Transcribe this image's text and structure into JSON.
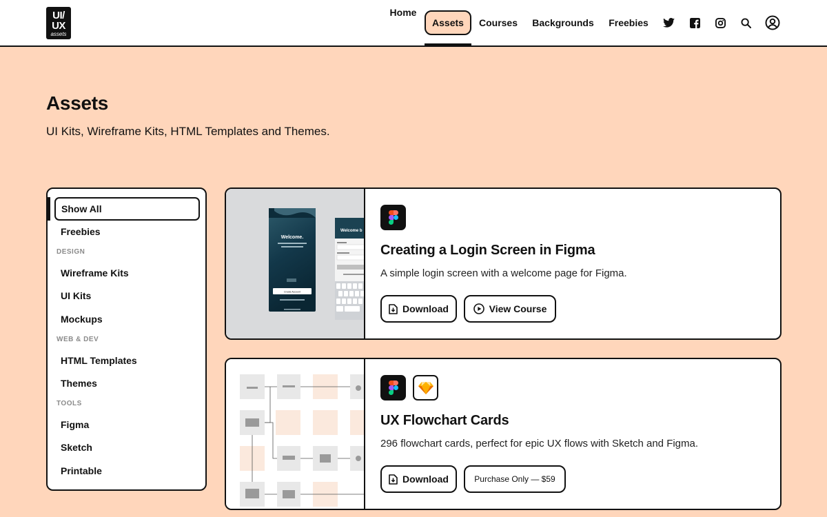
{
  "logo": {
    "line1": "UI/",
    "line2": "UX",
    "line3": "assets"
  },
  "nav": {
    "items": [
      {
        "label": "Home"
      },
      {
        "label": "Assets"
      },
      {
        "label": "Courses"
      },
      {
        "label": "Backgrounds"
      },
      {
        "label": "Freebies"
      }
    ],
    "active": "Assets",
    "icons": [
      "twitter-icon",
      "facebook-icon",
      "instagram-icon",
      "search-icon",
      "account-icon"
    ]
  },
  "page": {
    "title": "Assets",
    "subtitle": "UI Kits, Wireframe Kits, HTML Templates and Themes."
  },
  "sidebar": {
    "items": [
      {
        "label": "Show All"
      },
      {
        "label": "Freebies"
      },
      {
        "heading": "DESIGN"
      },
      {
        "label": "Wireframe Kits"
      },
      {
        "label": "UI Kits"
      },
      {
        "label": "Mockups"
      },
      {
        "heading": "WEB & DEV"
      },
      {
        "label": "HTML Templates"
      },
      {
        "label": "Themes"
      },
      {
        "heading": "TOOLS"
      },
      {
        "label": "Figma"
      },
      {
        "label": "Sketch"
      },
      {
        "label": "Printable"
      }
    ],
    "active": "Show All"
  },
  "cards": [
    {
      "title": "Creating a Login Screen in Figma",
      "description": "A simple login screen with a welcome page for Figma.",
      "tools": [
        "figma-icon"
      ],
      "thumb": {
        "welcome": "Welcome.",
        "welcome_back": "Welcome b",
        "create_account": "Create Account"
      },
      "buttons": [
        {
          "label": "Download",
          "icon": "download-icon"
        },
        {
          "label": "View Course",
          "icon": "play-icon"
        }
      ]
    },
    {
      "title": "UX Flowchart Cards",
      "description": "296 flowchart cards, perfect for epic UX flows with Sketch and Figma.",
      "tools": [
        "figma-icon",
        "sketch-icon"
      ],
      "buttons": [
        {
          "label": "Download",
          "icon": "download-icon"
        },
        {
          "label": "Purchase Only — $59"
        }
      ]
    }
  ],
  "colors": {
    "background": "#ffd6bb",
    "ink": "#111111",
    "surface": "#ffffff"
  }
}
